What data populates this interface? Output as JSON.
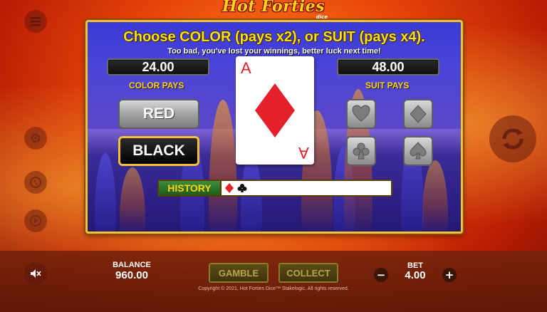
{
  "logo": {
    "title": "Hot Forties",
    "sub": "dice"
  },
  "panel": {
    "headline": "Choose COLOR (pays x2), or SUIT (pays x4).",
    "message": "Too bad, you've lost your winnings, better luck next time!",
    "color_value": "24.00",
    "suit_value": "48.00",
    "color_label": "COLOR PAYS",
    "suit_label": "SUIT PAYS",
    "red_label": "RED",
    "black_label": "BLACK",
    "card": {
      "rank": "A",
      "suit": "diamond"
    },
    "history_label": "HISTORY",
    "history": [
      "diamond",
      "club"
    ]
  },
  "bottom": {
    "balance_label": "BALANCE",
    "balance_value": "960.00",
    "gamble_label": "GAMBLE",
    "collect_label": "COLLECT",
    "bet_label": "BET",
    "bet_value": "4.00",
    "minus": "−",
    "plus": "+",
    "copyright": "Copyright © 2021, Hot Forties Dice™ Stakelogic. All rights reserved."
  },
  "colors": {
    "accent": "#f3c233",
    "red": "#e5202b",
    "panel": "#3b2a9e"
  }
}
